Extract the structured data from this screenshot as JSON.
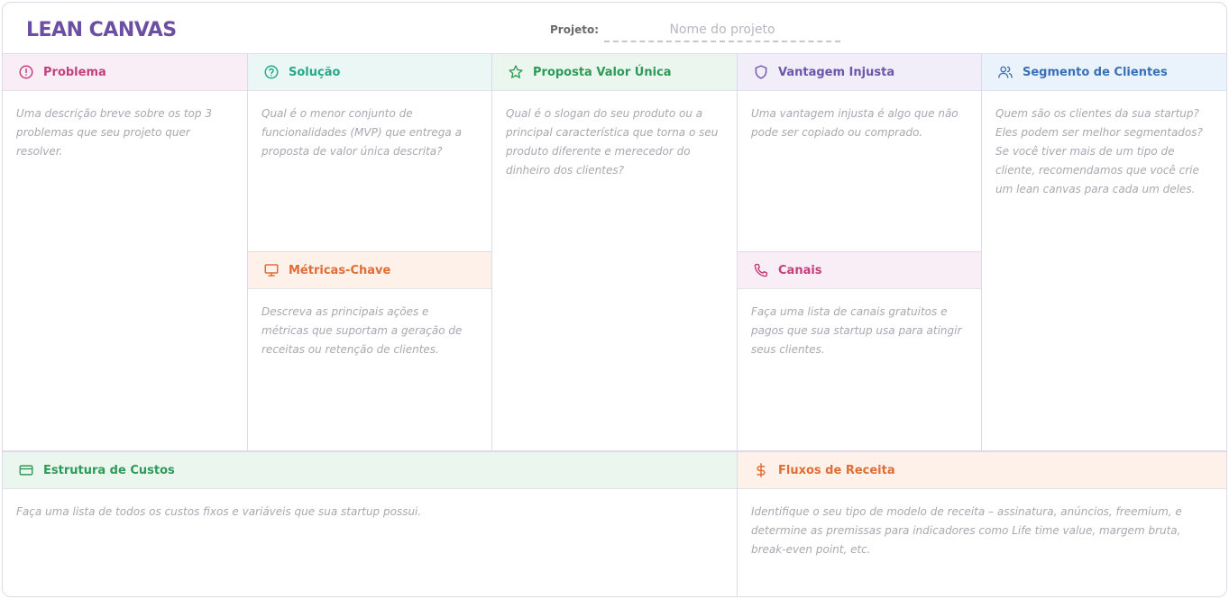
{
  "app": {
    "title": "LEAN CANVAS"
  },
  "project": {
    "label": "Projeto:",
    "placeholder": "Nome do projeto",
    "value": ""
  },
  "sections": {
    "problema": {
      "icon": "alert-circle-icon",
      "title": "Problema",
      "description": "Uma descrição breve sobre os top 3 problemas que seu projeto quer resolver."
    },
    "solucao": {
      "icon": "help-circle-icon",
      "title": "Solução",
      "description": "Qual é o menor conjunto de funcionalidades (MVP) que entrega a proposta de valor única descrita?"
    },
    "metricas": {
      "icon": "monitor-icon",
      "title": "Métricas-Chave",
      "description": "Descreva as principais ações e métricas que suportam a geração de receitas ou retenção de clientes."
    },
    "proposta": {
      "icon": "star-icon",
      "title": "Proposta Valor Única",
      "description": "Qual é o slogan do seu produto ou a principal característica que torna o seu produto diferente e merecedor do dinheiro dos clientes?"
    },
    "vantagem": {
      "icon": "shield-icon",
      "title": "Vantagem Injusta",
      "description": "Uma vantagem injusta é algo que não pode ser copiado ou comprado."
    },
    "canais": {
      "icon": "phone-icon",
      "title": "Canais",
      "description": "Faça uma lista de canais gratuitos e pagos que sua startup usa para atingir seus clientes."
    },
    "segmento": {
      "icon": "users-icon",
      "title": "Segmento de Clientes",
      "description": "Quem são os clientes da sua startup? Eles podem ser melhor segmentados? Se você tiver mais de um tipo de cliente, recomendamos que você crie um lean canvas para cada um deles."
    },
    "custos": {
      "icon": "credit-card-icon",
      "title": "Estrutura de Custos",
      "description": "Faça uma lista de todos os custos fixos e variáveis que sua startup possui."
    },
    "receita": {
      "icon": "dollar-icon",
      "title": "Fluxos de Receita",
      "description": "Identifique o seu tipo de modelo de receita – assinatura, anúncios, freemium, e determine as premissas para indicadores como Life time value, margem bruta, break-even point, etc."
    }
  },
  "colors": {
    "brand": "#6b4fa3",
    "pink": "#c43f7d",
    "mint": "#27a88a",
    "green": "#2e9a57",
    "lavender": "#6b56a8",
    "blue": "#3a70b5",
    "peach": "#e06d35"
  }
}
